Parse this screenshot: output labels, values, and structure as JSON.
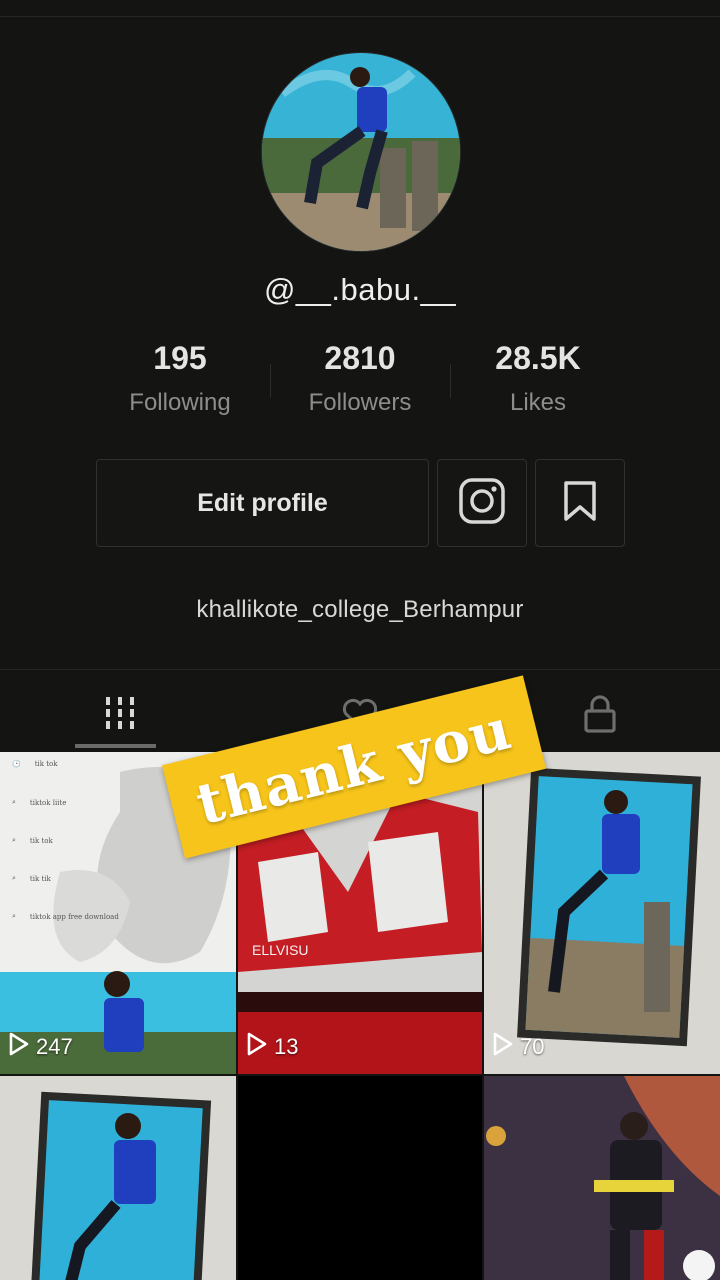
{
  "profile": {
    "username": "@__.babu.__",
    "bio": "khallikote_college_Berhampur"
  },
  "stats": [
    {
      "value": "195",
      "label": "Following"
    },
    {
      "value": "2810",
      "label": "Followers"
    },
    {
      "value": "28.5K",
      "label": "Likes"
    }
  ],
  "actions": {
    "edit_profile": "Edit profile"
  },
  "tabs": {
    "active": "videos"
  },
  "videos": [
    {
      "views": "247"
    },
    {
      "views": "13"
    },
    {
      "views": "70"
    }
  ],
  "thumb1": {
    "search_rows": [
      "tik tok",
      "tiktok liite",
      "tik tok",
      "tik tik",
      "tiktok app free download"
    ]
  },
  "thumb2": {
    "caption": "ELLVISU"
  },
  "sticker": {
    "text": "thank you"
  },
  "colors": {
    "background": "#141513",
    "sticker": "#f6c41a",
    "muted_text": "#8d8e8b"
  }
}
